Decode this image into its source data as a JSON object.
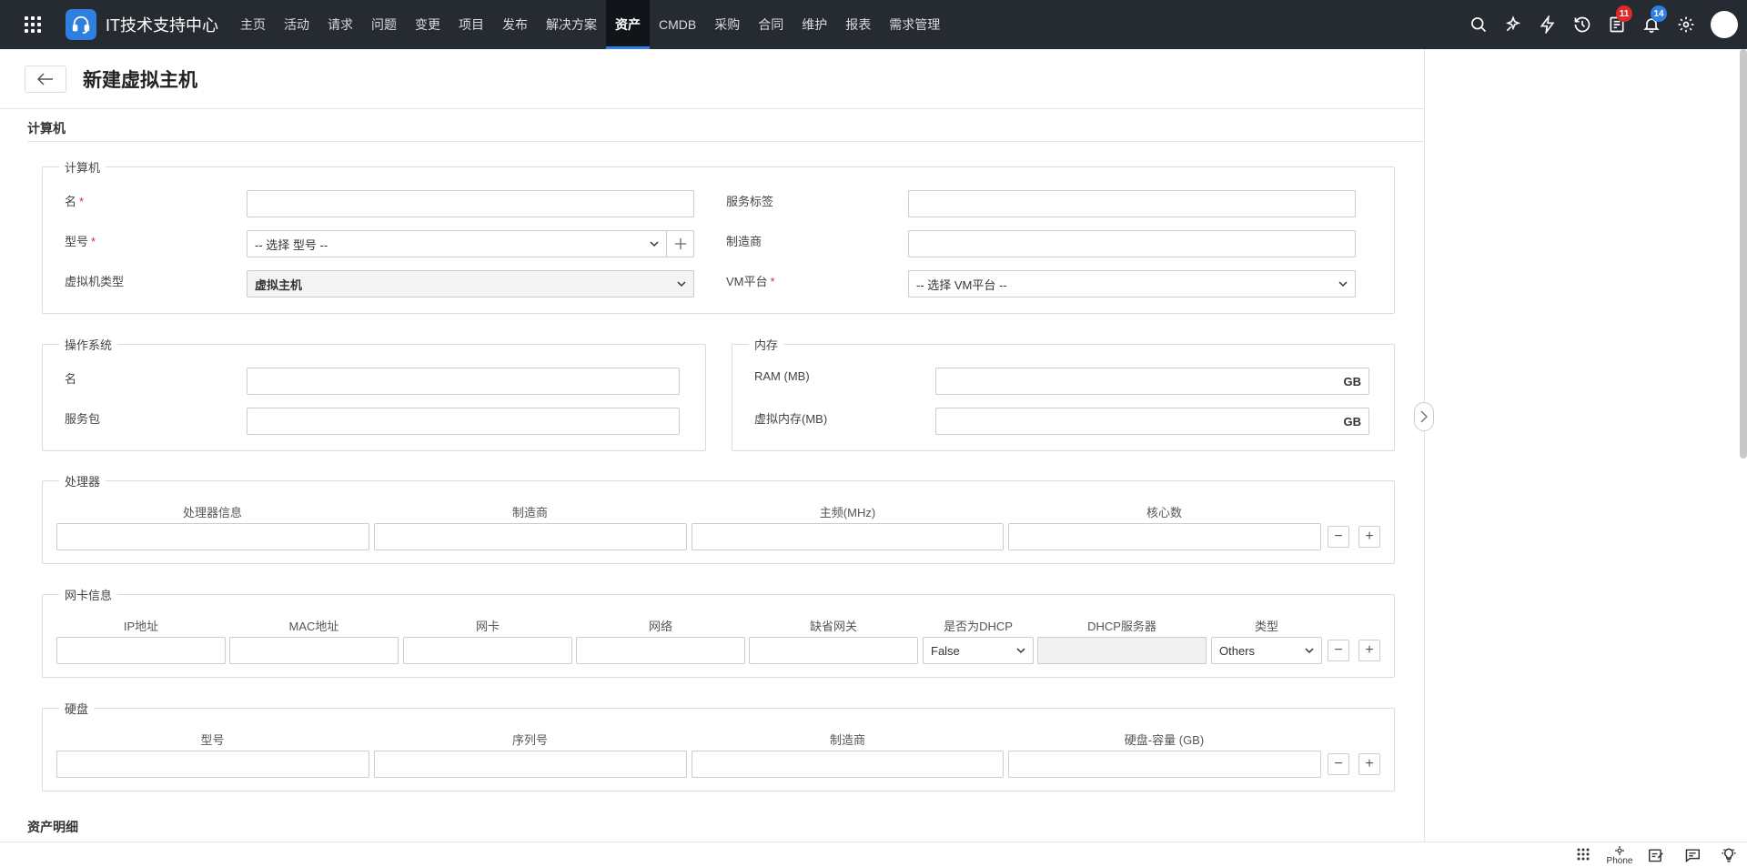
{
  "app": {
    "title": "IT技术支持中心"
  },
  "nav": {
    "items": [
      "主页",
      "活动",
      "请求",
      "问题",
      "变更",
      "项目",
      "发布",
      "解决方案",
      "资产",
      "CMDB",
      "采购",
      "合同",
      "维护",
      "报表",
      "需求管理"
    ],
    "active_index": 8
  },
  "header_icons": {
    "badge_tasks": "11",
    "badge_notifications": "14"
  },
  "page": {
    "title": "新建虚拟主机"
  },
  "section_computer": {
    "heading": "计算机",
    "legend": "计算机",
    "name_label": "名",
    "model_label": "型号",
    "model_placeholder": "-- 选择 型号 --",
    "vm_type_label": "虚拟机类型",
    "vm_type_value": "虚拟主机",
    "service_tag_label": "服务标签",
    "manufacturer_label": "制造商",
    "vm_platform_label": "VM平台",
    "vm_platform_placeholder": "-- 选择 VM平台 --",
    "required_mark": "*"
  },
  "os": {
    "legend": "操作系统",
    "name_label": "名",
    "service_pack_label": "服务包"
  },
  "memory": {
    "legend": "内存",
    "ram_label": "RAM (MB)",
    "virtual_label": "虚拟内存(MB)",
    "unit": "GB"
  },
  "processor": {
    "legend": "处理器",
    "columns": [
      "处理器信息",
      "制造商",
      "主频(MHz)",
      "核心数"
    ]
  },
  "nic": {
    "legend": "网卡信息",
    "columns": [
      "IP地址",
      "MAC地址",
      "网卡",
      "网络",
      "缺省网关",
      "是否为DHCP",
      "DHCP服务器",
      "类型"
    ],
    "dhcp_value": "False",
    "type_value": "Others"
  },
  "disk": {
    "legend": "硬盘",
    "columns": [
      "型号",
      "序列号",
      "制造商",
      "硬盘-容量 (GB)"
    ]
  },
  "asset_details": {
    "heading": "资产明细"
  },
  "footer": {
    "phone_label": "Phone"
  }
}
